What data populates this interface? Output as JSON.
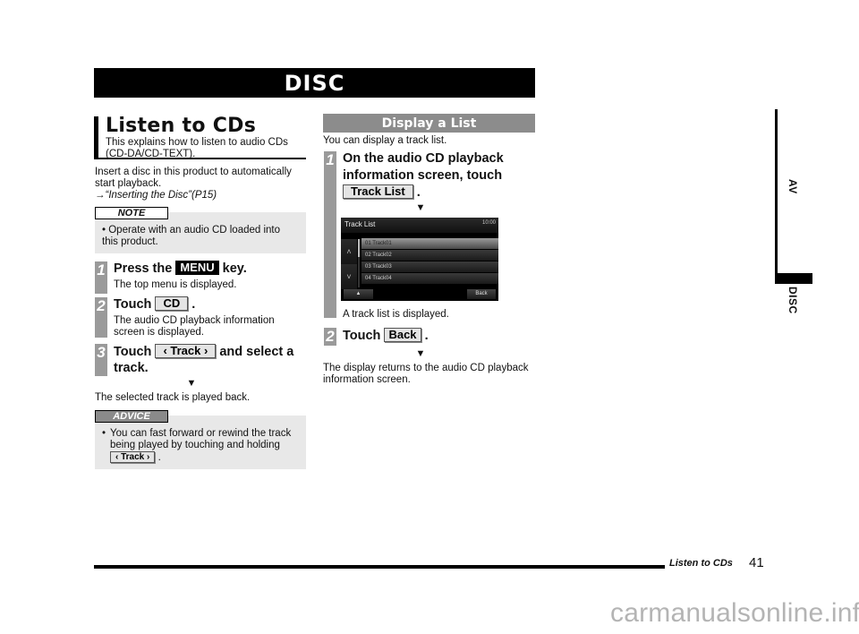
{
  "header": {
    "title": "DISC"
  },
  "side_tab": {
    "chapter": "AV",
    "section": "DISC"
  },
  "left_column": {
    "section_title": "Listen to CDs",
    "section_subtitle": "This explains how to listen to audio CDs (CD-DA/CD-TEXT).",
    "intro": "Insert a disc in this product to automatically start playback.",
    "reference": "→“Inserting the Disc”(P15)",
    "note": {
      "label": "NOTE",
      "items": [
        "Operate with an audio CD loaded into this product."
      ]
    },
    "steps": [
      {
        "number": "1",
        "prefix": "Press the",
        "key": "MENU",
        "suffix": "key.",
        "result": "The top menu is displayed."
      },
      {
        "number": "2",
        "prefix": "Touch",
        "key": "CD",
        "suffix": ".",
        "result": "The audio CD playback information screen is displayed."
      },
      {
        "number": "3",
        "prefix": "Touch",
        "key": "‹ Track ›",
        "suffix": "and select a track.",
        "result": ""
      }
    ],
    "result_arrow": "▼",
    "final_result": "The selected track is played back.",
    "advice": {
      "label": "ADVICE",
      "text": "You can fast forward or rewind the track being played by touching and holding",
      "key": "‹ Track ›",
      "suffix": "."
    }
  },
  "right_column": {
    "section_title": "Display a List",
    "intro": "You can display a track list.",
    "steps": [
      {
        "number": "1",
        "text": "On the audio CD playback information screen, touch",
        "key": "Track List",
        "suffix": ".",
        "result": "A track list is displayed."
      },
      {
        "number": "2",
        "prefix": "Touch",
        "key": "Back",
        "suffix": ".",
        "result": ""
      }
    ],
    "result_arrow": "▼",
    "final_result": "The display returns to the audio CD playback information screen.",
    "screen": {
      "title": "Track List",
      "clock": "10:00",
      "up_icon": "˄",
      "down_icon": "˅",
      "tracks": [
        "01  Track01",
        "02  Track02",
        "03  Track03",
        "04  Track04"
      ],
      "selected_index": 0,
      "eject_label": "▲",
      "back_label": "Back"
    }
  },
  "footer": {
    "section": "Listen to CDs",
    "page": "41"
  },
  "watermark": "carmanualsonline.info"
}
